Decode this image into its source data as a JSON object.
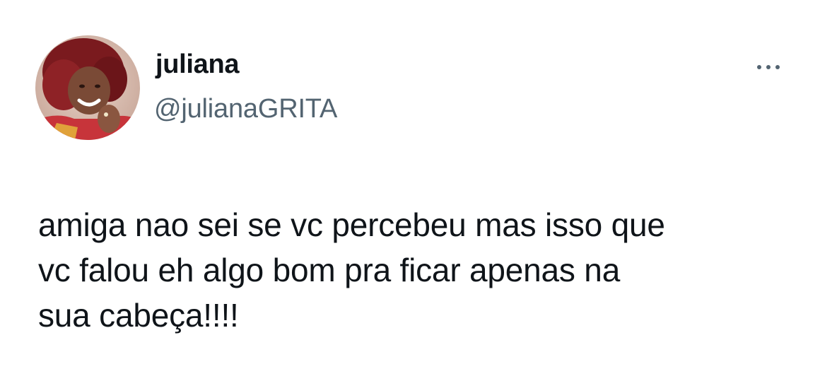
{
  "author": {
    "display_name": "juliana",
    "handle": "@julianaGRITA",
    "avatar_icon": "profile-photo-avatar"
  },
  "actions": {
    "more_icon": "more-options-icon"
  },
  "tweet": {
    "lines": [
      "amiga nao sei se vc percebeu mas isso que",
      "vc falou eh algo bom pra ficar apenas na",
      "sua cabeça!!!!"
    ]
  },
  "colors": {
    "text": "#0f1419",
    "secondary_text": "#536471",
    "background": "#ffffff"
  }
}
